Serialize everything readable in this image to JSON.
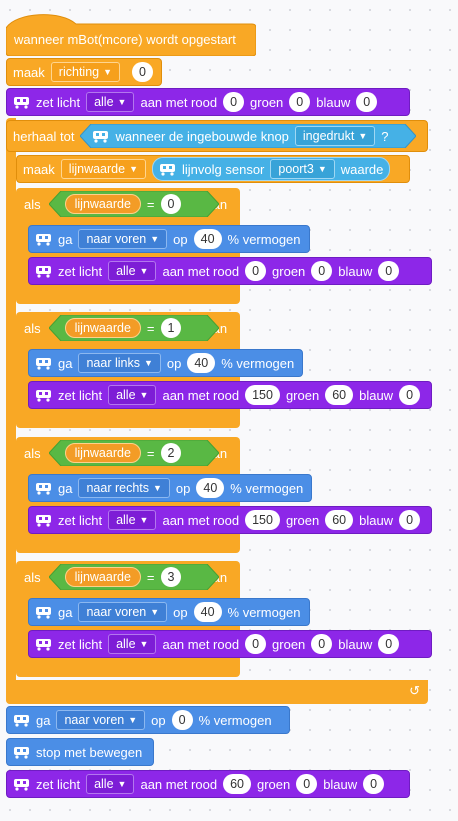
{
  "hat": {
    "label": "wanneer mBot(mcore) wordt opgestart"
  },
  "set_richting": {
    "label": "maak",
    "var": "richting",
    "value": "0"
  },
  "led1": {
    "label": "zet licht",
    "pos": "alle",
    "mid": "aan met rood",
    "red": "0",
    "green_lbl": "groen",
    "green": "0",
    "blue_lbl": "blauw",
    "blue": "0"
  },
  "repeat": {
    "label": "herhaal tot",
    "cond_text": "wanneer de ingebouwde knop",
    "cond_dd": "ingedrukt",
    "q": "?"
  },
  "set_lijn": {
    "label": "maak",
    "var": "lijnwaarde",
    "sensor_text": "lijnvolg sensor",
    "port": "poort3",
    "tail": "waarde"
  },
  "ifs": [
    {
      "als": "als",
      "var": "lijnwaarde",
      "eq": "=",
      "val": "0",
      "dan": "dan",
      "move": {
        "label": "ga",
        "dir": "naar voren",
        "op": "op",
        "speed": "40",
        "unit": "% vermogen"
      },
      "led": {
        "label": "zet licht",
        "pos": "alle",
        "mid": "aan met rood",
        "red": "0",
        "green_lbl": "groen",
        "green": "0",
        "blue_lbl": "blauw",
        "blue": "0"
      }
    },
    {
      "als": "als",
      "var": "lijnwaarde",
      "eq": "=",
      "val": "1",
      "dan": "dan",
      "move": {
        "label": "ga",
        "dir": "naar links",
        "op": "op",
        "speed": "40",
        "unit": "% vermogen"
      },
      "led": {
        "label": "zet licht",
        "pos": "alle",
        "mid": "aan met rood",
        "red": "150",
        "green_lbl": "groen",
        "green": "60",
        "blue_lbl": "blauw",
        "blue": "0"
      }
    },
    {
      "als": "als",
      "var": "lijnwaarde",
      "eq": "=",
      "val": "2",
      "dan": "dan",
      "move": {
        "label": "ga",
        "dir": "naar rechts",
        "op": "op",
        "speed": "40",
        "unit": "% vermogen"
      },
      "led": {
        "label": "zet licht",
        "pos": "alle",
        "mid": "aan met rood",
        "red": "150",
        "green_lbl": "groen",
        "green": "60",
        "blue_lbl": "blauw",
        "blue": "0"
      }
    },
    {
      "als": "als",
      "var": "lijnwaarde",
      "eq": "=",
      "val": "3",
      "dan": "dan",
      "move": {
        "label": "ga",
        "dir": "naar voren",
        "op": "op",
        "speed": "40",
        "unit": "% vermogen"
      },
      "led": {
        "label": "zet licht",
        "pos": "alle",
        "mid": "aan met rood",
        "red": "0",
        "green_lbl": "groen",
        "green": "0",
        "blue_lbl": "blauw",
        "blue": "0"
      }
    }
  ],
  "final_move": {
    "label": "ga",
    "dir": "naar voren",
    "op": "op",
    "speed": "0",
    "unit": "% vermogen"
  },
  "stop": {
    "label": "stop met bewegen"
  },
  "led_final": {
    "label": "zet licht",
    "pos": "alle",
    "mid": "aan met rood",
    "red": "60",
    "green_lbl": "groen",
    "green": "0",
    "blue_lbl": "blauw",
    "blue": "0"
  },
  "icons": {
    "robot": "robot-icon",
    "loop": "loop-arrow-icon",
    "dropdown": "dropdown-arrow-icon"
  },
  "colors": {
    "events": "#f9a825",
    "motion": "#4b8ee6",
    "looks": "#8d27e8",
    "sensing": "#45b1e6",
    "operators": "#59b844",
    "variables": "#f39c26"
  }
}
